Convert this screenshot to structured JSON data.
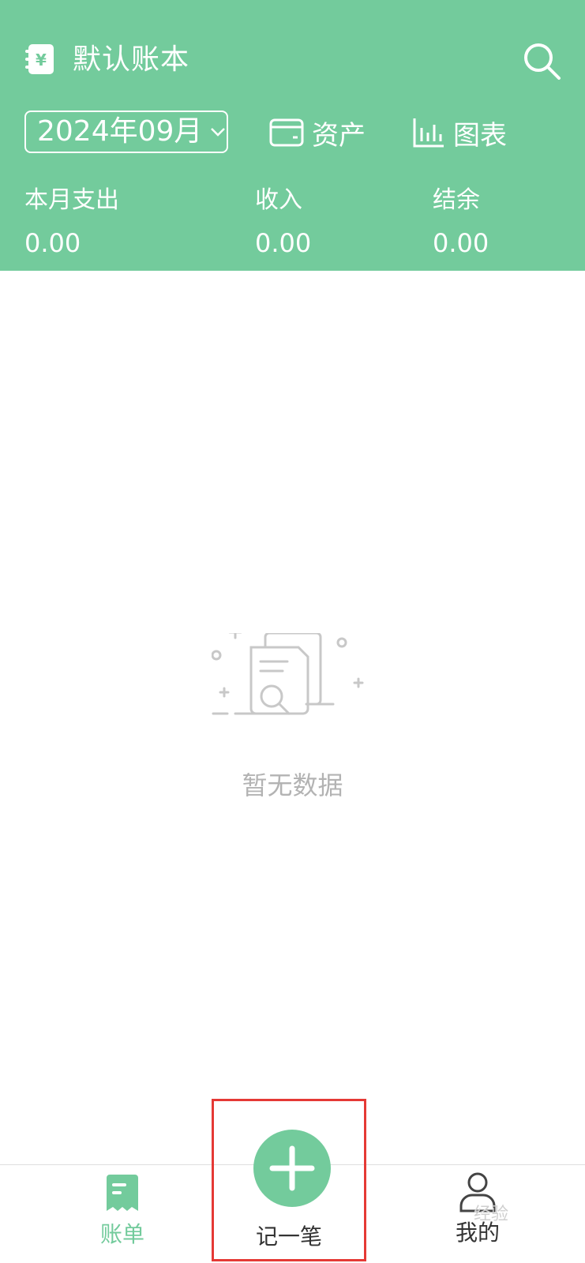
{
  "header": {
    "title": "默认账本",
    "month": "2024年09月",
    "assets_label": "资产",
    "charts_label": "图表",
    "icons": [
      "book-yen-icon",
      "search-icon",
      "chevron-down-icon",
      "wallet-icon",
      "bar-chart-icon"
    ]
  },
  "summary": {
    "expense_label": "本月支出",
    "expense_value": "0.00",
    "income_label": "收入",
    "income_value": "0.00",
    "balance_label": "结余",
    "balance_value": "0.00"
  },
  "empty_state": {
    "text": "暂无数据",
    "icon": "empty-document-search-icon"
  },
  "tabs": {
    "bills": "账单",
    "add": "记一笔",
    "mine": "我的"
  },
  "watermark": "经验",
  "colors": {
    "accent": "#73CB9C",
    "highlight_box": "#e53935"
  }
}
